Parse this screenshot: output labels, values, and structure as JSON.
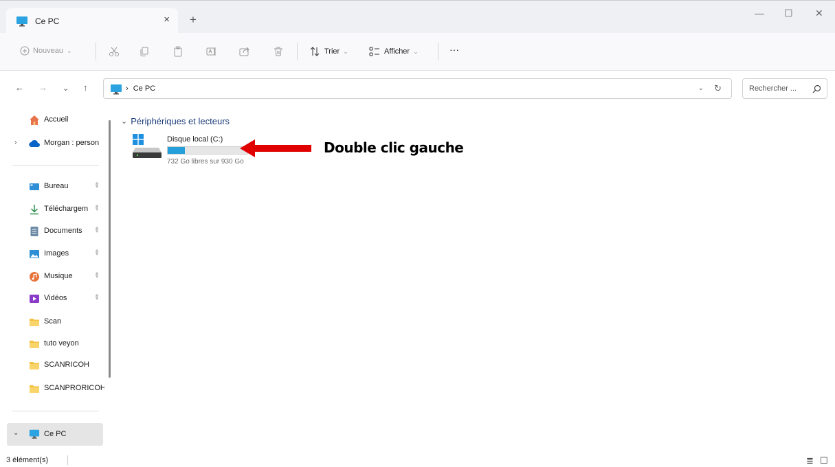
{
  "window": {
    "tab_title": "Ce PC",
    "tab_close": "×",
    "new_tab": "+",
    "minimize": "—",
    "maximize": "☐",
    "close": "✕"
  },
  "toolbar": {
    "new_label": "Nouveau",
    "sort_label": "Trier",
    "view_label": "Afficher",
    "more_label": "···",
    "icons": [
      "cut-icon",
      "copy-icon",
      "paste-icon",
      "rename-icon",
      "share-icon",
      "delete-icon"
    ]
  },
  "address": {
    "crumb": "Ce PC",
    "crumb_sep": "›",
    "search_placeholder": "Rechercher ..."
  },
  "sidebar": {
    "items": [
      {
        "label": "Accueil",
        "icon": "home-icon"
      },
      {
        "label": "Morgan : person",
        "icon": "onedrive-cloud-icon",
        "expandable": true
      },
      {
        "label": "Bureau",
        "icon": "desktop-icon",
        "pinned": true
      },
      {
        "label": "Téléchargem",
        "icon": "download-icon",
        "pinned": true
      },
      {
        "label": "Documents",
        "icon": "documents-icon",
        "pinned": true
      },
      {
        "label": "Images",
        "icon": "pictures-icon",
        "pinned": true
      },
      {
        "label": "Musique",
        "icon": "music-icon",
        "pinned": true
      },
      {
        "label": "Vidéos",
        "icon": "videos-icon",
        "pinned": true
      },
      {
        "label": "Scan",
        "icon": "folder-icon"
      },
      {
        "label": "tuto veyon",
        "icon": "folder-icon"
      },
      {
        "label": "SCANRICOH",
        "icon": "folder-icon"
      },
      {
        "label": "SCANPRORICOH",
        "icon": "folder-icon"
      },
      {
        "label": "Ce PC",
        "icon": "computer-icon",
        "expanded": true,
        "selected": true
      }
    ]
  },
  "content": {
    "group_title": "Périphériques et lecteurs",
    "drive": {
      "name": "Disque local (C:)",
      "free_text": "732 Go libres sur 930 Go",
      "used_fraction": 0.213
    }
  },
  "annotation": {
    "text": "Double clic gauche",
    "arrow_color": "#e00000"
  },
  "statusbar": {
    "count_text": "3 élément(s)"
  },
  "colors": {
    "accent": "#26a0da",
    "group_title": "#1c3d7a",
    "selection": "#e5e5e5"
  }
}
